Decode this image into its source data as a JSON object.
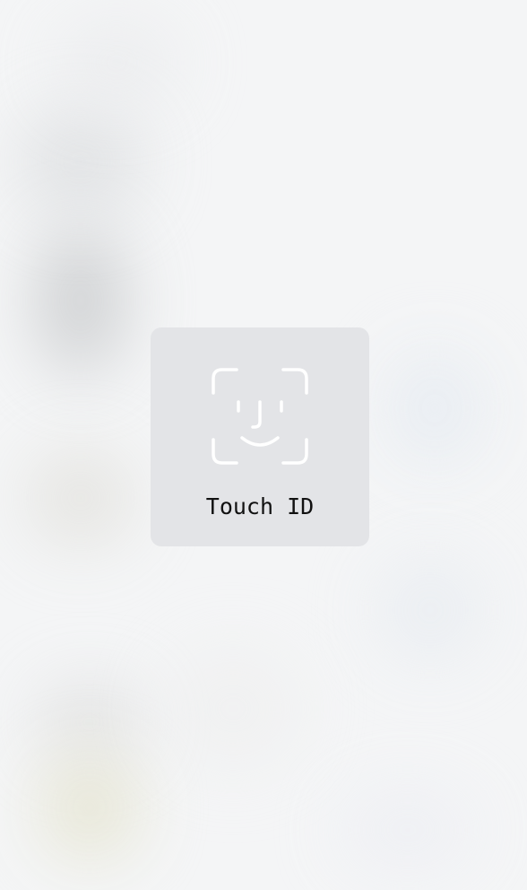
{
  "biometric_prompt": {
    "label": "Touch ID",
    "icon": "face-id-icon"
  }
}
